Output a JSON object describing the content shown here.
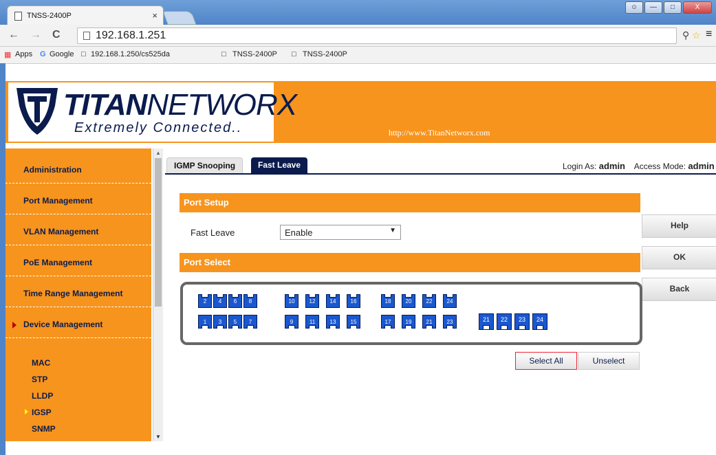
{
  "browser": {
    "tab_title": "TNSS-2400P",
    "tab_close": "×",
    "url": "192.168.1.251",
    "nav_back": "←",
    "nav_forward": "→",
    "nav_reload": "C",
    "menu": "≡",
    "bookmarks": [
      {
        "label": "Apps"
      },
      {
        "label": "Google"
      },
      {
        "label": "192.168.1.250/cs525da"
      },
      {
        "label": "TNSS-2400P"
      },
      {
        "label": "TNSS-2400P"
      }
    ]
  },
  "header": {
    "brand_bold": "TITAN",
    "brand_light": "NETWORX",
    "tagline": "Extremely Connected..",
    "site_url": "http://www.TitanNetworx.com"
  },
  "sidebar": {
    "items": [
      {
        "label": "Administration"
      },
      {
        "label": "Port Management"
      },
      {
        "label": "VLAN Management"
      },
      {
        "label": "PoE Management"
      },
      {
        "label": "Time Range Management"
      },
      {
        "label": "Device Management",
        "active": true
      }
    ],
    "subitems": [
      {
        "label": "MAC"
      },
      {
        "label": "STP"
      },
      {
        "label": "LLDP"
      },
      {
        "label": "IGSP",
        "active": true
      },
      {
        "label": "SNMP"
      }
    ]
  },
  "tabs": [
    {
      "label": "IGMP Snooping"
    },
    {
      "label": "Fast Leave",
      "active": true
    }
  ],
  "session": {
    "login_label": "Login As:",
    "login_value": "admin",
    "access_label": "Access Mode:",
    "access_value": "admin"
  },
  "port_setup": {
    "title": "Port Setup",
    "fast_leave_label": "Fast Leave",
    "fast_leave_value": "Enable"
  },
  "port_select": {
    "title": "Port Select",
    "top_row": [
      "2",
      "4",
      "6",
      "8",
      "10",
      "12",
      "14",
      "16",
      "18",
      "20",
      "22",
      "24"
    ],
    "bottom_row": [
      "1",
      "3",
      "5",
      "7",
      "9",
      "11",
      "13",
      "15",
      "17",
      "19",
      "21",
      "23"
    ],
    "sfp": [
      "21",
      "22",
      "23",
      "24"
    ],
    "select_all": "Select All",
    "unselect": "Unselect"
  },
  "side_buttons": {
    "help": "Help",
    "ok": "OK",
    "back": "Back"
  },
  "colors": {
    "accent": "#f7941d",
    "navy": "#0b1b4d",
    "port": "#1b58ce"
  }
}
